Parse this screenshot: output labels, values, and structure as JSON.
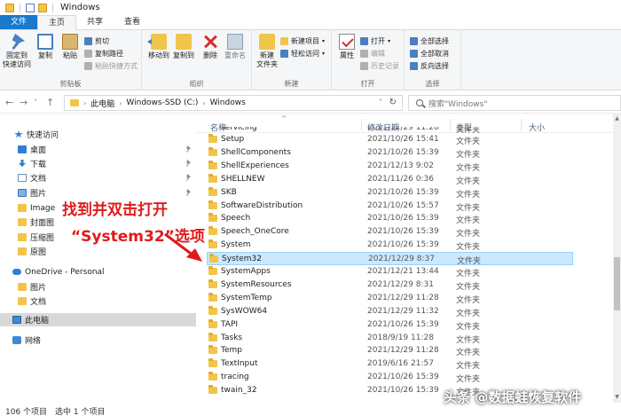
{
  "window": {
    "title": "Windows"
  },
  "tabs": [
    {
      "label": "文件"
    },
    {
      "label": "主页"
    },
    {
      "label": "共享"
    },
    {
      "label": "查看"
    }
  ],
  "ribbon": {
    "clipboard": {
      "label": "剪贴板",
      "pin_quick_access": "固定到\n快速访问",
      "copy": "复制",
      "paste": "粘贴",
      "cut": "剪切",
      "copy_path": "复制路径",
      "paste_shortcut": "粘贴快捷方式"
    },
    "organize": {
      "label": "组织",
      "move_to": "移动到",
      "copy_to": "复制到",
      "delete": "删除",
      "rename": "重命名"
    },
    "new": {
      "label": "新建",
      "new_folder": "新建\n文件夹",
      "new_item": "新建项目",
      "easy_access": "轻松访问"
    },
    "open": {
      "label": "打开",
      "properties": "属性",
      "open": "打开",
      "edit": "编辑",
      "history": "历史记录"
    },
    "select": {
      "label": "选择",
      "select_all": "全部选择",
      "select_none": "全部取消",
      "invert": "反向选择"
    }
  },
  "address": {
    "segments": [
      "此电脑",
      "Windows-SSD (C:)",
      "Windows"
    ],
    "search_placeholder": "搜索\"Windows\""
  },
  "sidebar": {
    "items": [
      {
        "label": "快速访问",
        "icon": "star-icon",
        "pinned": false
      },
      {
        "label": "桌面",
        "icon": "desktop-icon",
        "pinned": true
      },
      {
        "label": "下载",
        "icon": "download-icon",
        "pinned": true
      },
      {
        "label": "文档",
        "icon": "document-icon",
        "pinned": true
      },
      {
        "label": "图片",
        "icon": "picture-icon",
        "pinned": true
      },
      {
        "label": "Image",
        "icon": "folder-icon",
        "pinned": false
      },
      {
        "label": "封面图",
        "icon": "folder-icon",
        "pinned": false
      },
      {
        "label": "压缩图",
        "icon": "folder-icon",
        "pinned": false
      },
      {
        "label": "原图",
        "icon": "folder-icon",
        "pinned": false
      },
      {
        "label": "OneDrive - Personal",
        "icon": "cloud-icon",
        "pinned": false
      },
      {
        "label": "图片",
        "icon": "folder-icon",
        "pinned": false
      },
      {
        "label": "文档",
        "icon": "folder-icon",
        "pinned": false
      },
      {
        "label": "此电脑",
        "icon": "computer-icon",
        "pinned": false
      },
      {
        "label": "网络",
        "icon": "network-icon",
        "pinned": false
      }
    ]
  },
  "columns": {
    "name": "名称",
    "modified": "修改日期",
    "type": "类型",
    "size": "大小"
  },
  "files": [
    {
      "name": "servicing",
      "date": "2021/12/29 11:28",
      "type": "文件夹"
    },
    {
      "name": "Setup",
      "date": "2021/10/26 15:41",
      "type": "文件夹"
    },
    {
      "name": "ShellComponents",
      "date": "2021/10/26 15:39",
      "type": "文件夹"
    },
    {
      "name": "ShellExperiences",
      "date": "2021/12/13 9:02",
      "type": "文件夹"
    },
    {
      "name": "SHELLNEW",
      "date": "2021/11/26 0:36",
      "type": "文件夹"
    },
    {
      "name": "SKB",
      "date": "2021/10/26 15:39",
      "type": "文件夹"
    },
    {
      "name": "SoftwareDistribution",
      "date": "2021/10/26 15:57",
      "type": "文件夹"
    },
    {
      "name": "Speech",
      "date": "2021/10/26 15:39",
      "type": "文件夹"
    },
    {
      "name": "Speech_OneCore",
      "date": "2021/10/26 15:39",
      "type": "文件夹"
    },
    {
      "name": "System",
      "date": "2021/10/26 15:39",
      "type": "文件夹"
    },
    {
      "name": "System32",
      "date": "2021/12/29 8:37",
      "type": "文件夹"
    },
    {
      "name": "SystemApps",
      "date": "2021/12/21 13:44",
      "type": "文件夹"
    },
    {
      "name": "SystemResources",
      "date": "2021/12/29 8:31",
      "type": "文件夹"
    },
    {
      "name": "SystemTemp",
      "date": "2021/12/29 11:28",
      "type": "文件夹"
    },
    {
      "name": "SysWOW64",
      "date": "2021/12/29 11:32",
      "type": "文件夹"
    },
    {
      "name": "TAPI",
      "date": "2021/10/26 15:39",
      "type": "文件夹"
    },
    {
      "name": "Tasks",
      "date": "2018/9/19 11:28",
      "type": "文件夹"
    },
    {
      "name": "Temp",
      "date": "2021/12/29 11:28",
      "type": "文件夹"
    },
    {
      "name": "TextInput",
      "date": "2019/6/16 21:57",
      "type": "文件夹"
    },
    {
      "name": "tracing",
      "date": "2021/10/26 15:39",
      "type": "文件夹"
    },
    {
      "name": "twain_32",
      "date": "2021/10/26 15:39",
      "type": "文件夹"
    }
  ],
  "selected_file": "System32",
  "status": {
    "count": "106 个项目",
    "selected": "选中 1 个项目"
  },
  "annotation": {
    "line1": "找到并双击打开",
    "line2": "“System32”选项",
    "color": "#e01a1a"
  },
  "watermark": "头条 @数据蛙恢复软件",
  "colors": {
    "file_tab": "#1979ca",
    "selection": "#cce8ff",
    "folder": "#f0c54a"
  }
}
